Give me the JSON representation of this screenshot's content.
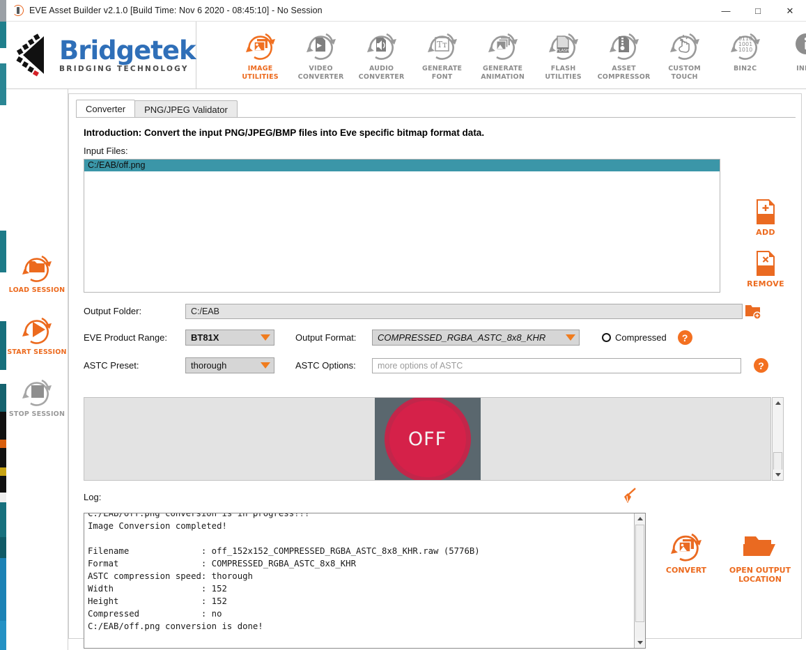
{
  "window": {
    "title": "EVE Asset Builder v2.1.0 [Build Time: Nov  6 2020 - 08:45:10] - No Session",
    "app_icon": "eve-app-icon",
    "minimize": "—",
    "maximize": "□",
    "close": "✕"
  },
  "brand": {
    "name": "Bridgetek",
    "tagline": "BRIDGING   TECHNOLOGY",
    "logo_icon": "bridgetek-chevron-logo",
    "blue": "#2f6fb8",
    "orange": "#ec6a1e"
  },
  "toolbar": {
    "items": [
      {
        "id": "image-utilities",
        "line1": "IMAGE",
        "line2": "UTILITIES",
        "icon": "image-utilities-icon",
        "active": true
      },
      {
        "id": "video-converter",
        "line1": "VIDEO",
        "line2": "CONVERTER",
        "icon": "video-converter-icon",
        "active": false
      },
      {
        "id": "audio-converter",
        "line1": "AUDIO",
        "line2": "CONVERTER",
        "icon": "audio-converter-icon",
        "active": false
      },
      {
        "id": "generate-font",
        "line1": "GENERATE",
        "line2": "FONT",
        "icon": "generate-font-icon",
        "active": false
      },
      {
        "id": "generate-animation",
        "line1": "GENERATE",
        "line2": "ANIMATION",
        "icon": "generate-animation-icon",
        "active": false
      },
      {
        "id": "flash-utilities",
        "line1": "FLASH",
        "line2": "UTILITIES",
        "icon": "flash-utilities-icon",
        "active": false
      },
      {
        "id": "asset-compressor",
        "line1": "ASSET",
        "line2": "COMPRESSOR",
        "icon": "asset-compressor-icon",
        "active": false
      },
      {
        "id": "custom-touch",
        "line1": "CUSTOM",
        "line2": "TOUCH",
        "icon": "custom-touch-icon",
        "active": false
      },
      {
        "id": "bin2c",
        "line1": "BIN2C",
        "line2": "",
        "icon": "bin2c-icon",
        "active": false
      },
      {
        "id": "info",
        "line1": "INFO",
        "line2": "",
        "icon": "info-icon",
        "active": false
      }
    ],
    "bin2c_digits": [
      "0110",
      "1001",
      "1010"
    ],
    "flash_badge": "FLASH"
  },
  "rail": {
    "items": [
      {
        "id": "load-session",
        "label": "LOAD SESSION",
        "icon": "folder-refresh-icon",
        "enabled": true
      },
      {
        "id": "start-session",
        "label": "START SESSION",
        "icon": "play-refresh-icon",
        "enabled": true
      },
      {
        "id": "stop-session",
        "label": "STOP SESSION",
        "icon": "stop-refresh-icon",
        "enabled": false
      }
    ]
  },
  "tabs": [
    {
      "id": "converter",
      "label": "Converter",
      "active": true
    },
    {
      "id": "validator",
      "label": "PNG/JPEG Validator",
      "active": false
    }
  ],
  "converter": {
    "introduction": "Introduction: Convert the input PNG/JPEG/BMP files into Eve specific bitmap format data.",
    "input_files_label": "Input Files:",
    "input_files": [
      {
        "path": "C:/EAB/off.png",
        "selected": true
      }
    ],
    "add_button": {
      "label": "ADD",
      "icon": "document-plus-icon"
    },
    "remove_button": {
      "label": "REMOVE",
      "icon": "document-x-icon"
    },
    "output_folder_label": "Output Folder:",
    "output_folder_value": "C:/EAB",
    "browse_icon": "folder-add-icon",
    "product_range_label": "EVE Product Range:",
    "product_range_value": "BT81X",
    "output_format_label": "Output Format:",
    "output_format_value": "COMPRESSED_RGBA_ASTC_8x8_KHR",
    "compressed_label": "Compressed",
    "compressed_checked": false,
    "help_icon": "help-question-icon",
    "astc_preset_label": "ASTC Preset:",
    "astc_preset_value": "thorough",
    "astc_options_label": "ASTC Options:",
    "astc_options_value": "",
    "astc_options_placeholder": "more options of ASTC"
  },
  "preview": {
    "image_name": "off-png-preview",
    "text": "OFF",
    "background_color": "#5a676e",
    "circle_color": "#d52149",
    "circle_ring_color": "#c2264a",
    "scrollbar_up": "▲",
    "scrollbar_down": "▼"
  },
  "log": {
    "label": "Log:",
    "clear_icon": "broom-clear-icon",
    "content": "C:/EAB/off.png conversion is in progress!!!\nImage Conversion completed!\n\nFilename              : off_152x152_COMPRESSED_RGBA_ASTC_8x8_KHR.raw (5776B)\nFormat                : COMPRESSED_RGBA_ASTC_8x8_KHR\nASTC compression speed: thorough\nWidth                 : 152\nHeight                : 152\nCompressed            : no\nC:/EAB/off.png conversion is done!"
  },
  "bottom_actions": [
    {
      "id": "convert",
      "line1": "CONVERT",
      "line2": "",
      "icon": "convert-image-icon"
    },
    {
      "id": "open-output-location",
      "line1": "OPEN OUTPUT",
      "line2": "LOCATION",
      "icon": "open-folder-icon"
    }
  ]
}
